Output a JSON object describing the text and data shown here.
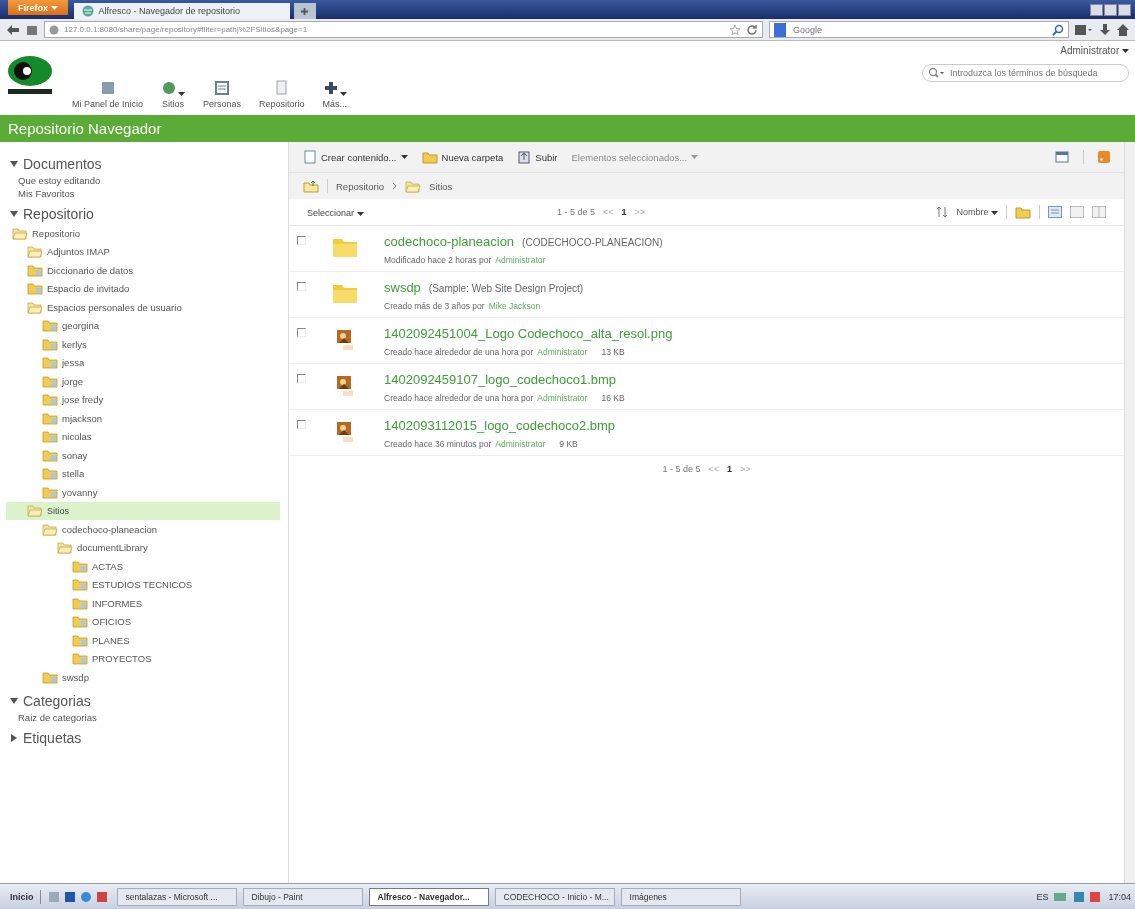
{
  "browser": {
    "menu_button": "Firefox",
    "tabs": [
      {
        "title": "Alfresco - Navegador de repositorio",
        "selected": true
      }
    ],
    "url": "127.0.0.1:8080/share/page/repository#filter=path|%2FSitios&page=1",
    "search": {
      "placeholder": "Google"
    }
  },
  "header": {
    "nav": [
      {
        "label": "Mi Panel de Inicio",
        "dropdown": false
      },
      {
        "label": "Sitios",
        "dropdown": true
      },
      {
        "label": "Personas",
        "dropdown": false
      },
      {
        "label": "Repositorio",
        "dropdown": false
      },
      {
        "label": "Más...",
        "dropdown": true
      }
    ],
    "user": "Administrator",
    "search": {
      "placeholder": "Introduzca los términos de búsqueda"
    }
  },
  "page_title": "Repositorio Navegador",
  "sidebar": {
    "sections": [
      {
        "title": "Documentos",
        "expanded": true,
        "kind": "links",
        "items": [
          {
            "label": "Que estoy editando"
          },
          {
            "label": "Mis Favoritos"
          }
        ]
      },
      {
        "title": "Repositorio",
        "expanded": true,
        "kind": "tree",
        "items": [
          {
            "label": "Repositorio",
            "expanded": true,
            "selected": false,
            "children": [
              {
                "label": "Adjuntos IMAP",
                "expanded": true,
                "selected": false
              },
              {
                "label": "Diccionario de datos",
                "expanded": false,
                "selected": false
              },
              {
                "label": "Espacio de invitado",
                "expanded": false,
                "selected": false
              },
              {
                "label": "Espacios personales de usuario",
                "expanded": true,
                "selected": false,
                "children": [
                  {
                    "label": "georgina",
                    "expanded": false,
                    "selected": false
                  },
                  {
                    "label": "kerlys",
                    "expanded": false,
                    "selected": false
                  },
                  {
                    "label": "jessa",
                    "expanded": false,
                    "selected": false
                  },
                  {
                    "label": "jorge",
                    "expanded": false,
                    "selected": false
                  },
                  {
                    "label": "jose fredy",
                    "expanded": false,
                    "selected": false
                  },
                  {
                    "label": "mjackson",
                    "expanded": false,
                    "selected": false
                  },
                  {
                    "label": "nicolas",
                    "expanded": false,
                    "selected": false
                  },
                  {
                    "label": "sonay",
                    "expanded": false,
                    "selected": false
                  },
                  {
                    "label": "stella",
                    "expanded": false,
                    "selected": false
                  },
                  {
                    "label": "yovanny",
                    "expanded": false,
                    "selected": false
                  }
                ]
              },
              {
                "label": "Sitios",
                "expanded": true,
                "selected": true,
                "children": [
                  {
                    "label": "codechoco-planeacion",
                    "expanded": true,
                    "selected": false,
                    "children": [
                      {
                        "label": "documentLibrary",
                        "expanded": true,
                        "selected": false,
                        "children": [
                          {
                            "label": "ACTAS",
                            "expanded": false,
                            "selected": false
                          },
                          {
                            "label": "ESTUDIOS TECNICOS",
                            "expanded": false,
                            "selected": false
                          },
                          {
                            "label": "INFORMES",
                            "expanded": false,
                            "selected": false
                          },
                          {
                            "label": "OFICIOS",
                            "expanded": false,
                            "selected": false
                          },
                          {
                            "label": "PLANES",
                            "expanded": false,
                            "selected": false
                          },
                          {
                            "label": "PROYECTOS",
                            "expanded": false,
                            "selected": false
                          }
                        ]
                      }
                    ]
                  },
                  {
                    "label": "swsdp",
                    "expanded": false,
                    "selected": false
                  }
                ]
              }
            ]
          }
        ]
      },
      {
        "title": "Categorias",
        "expanded": true,
        "kind": "links",
        "items": [
          {
            "label": "Raiz de categorias"
          }
        ]
      },
      {
        "title": "Etiquetas",
        "expanded": false
      }
    ]
  },
  "toolbar": {
    "buttons": [
      {
        "label": "Crear contenido...",
        "dropdown": true,
        "disabled": false
      },
      {
        "label": "Nueva carpeta",
        "dropdown": false,
        "disabled": false
      },
      {
        "label": "Subir",
        "dropdown": false,
        "disabled": false
      },
      {
        "label": "Elementos seleccionados...",
        "dropdown": true,
        "disabled": true
      }
    ]
  },
  "breadcrumb": [
    "Repositorio",
    "Sitios"
  ],
  "list_header": {
    "select": "Seleccionar",
    "pager": {
      "range": "1 - 5 de 5",
      "prev": "<<",
      "page": "1",
      "next": ">>"
    },
    "sort": "Nombre"
  },
  "rows": [
    {
      "kind": "folder",
      "checked": false,
      "name": "codechoco-planeacion",
      "title": "(CODECHOCO-PLANEACION)",
      "meta": "Modificado hace 2 horas por",
      "author": "Administrator"
    },
    {
      "kind": "folder",
      "checked": false,
      "name": "swsdp",
      "title": "(Sample: Web Site Design Project)",
      "meta": "Creado más de 3 años por",
      "author": "Mike Jackson"
    },
    {
      "kind": "image",
      "checked": false,
      "name": "1402092451004_Logo Codechoco_alta_resol.png",
      "meta": "Creado hace alrededor de una hora por",
      "author": "Administrator",
      "size": "13 KB"
    },
    {
      "kind": "image",
      "checked": false,
      "name": "1402092459107_logo_codechoco1.bmp",
      "meta": "Creado hace alrededor de una hora por",
      "author": "Administrator",
      "size": "16 KB"
    },
    {
      "kind": "image",
      "checked": false,
      "name": "1402093112015_logo_codechoco2.bmp",
      "meta": "Creado hace 36 minutos por",
      "author": "Administrator",
      "size": "9 KB"
    }
  ],
  "footer_pager": {
    "range": "1 - 5 de 5",
    "prev": "<<",
    "page": "1",
    "next": ">>"
  },
  "taskbar": {
    "start": "Inicio",
    "tasks": [
      {
        "label": "sentalazas - Microsoft ...",
        "selected": false
      },
      {
        "label": "Dibujo - Paint",
        "selected": false
      },
      {
        "label": "Alfresco - Navegador...",
        "selected": true
      },
      {
        "label": "CODECHOCO - Inicio - M...",
        "selected": false
      },
      {
        "label": "Imágenes",
        "selected": false
      }
    ],
    "language": "ES",
    "time": "17:04"
  }
}
